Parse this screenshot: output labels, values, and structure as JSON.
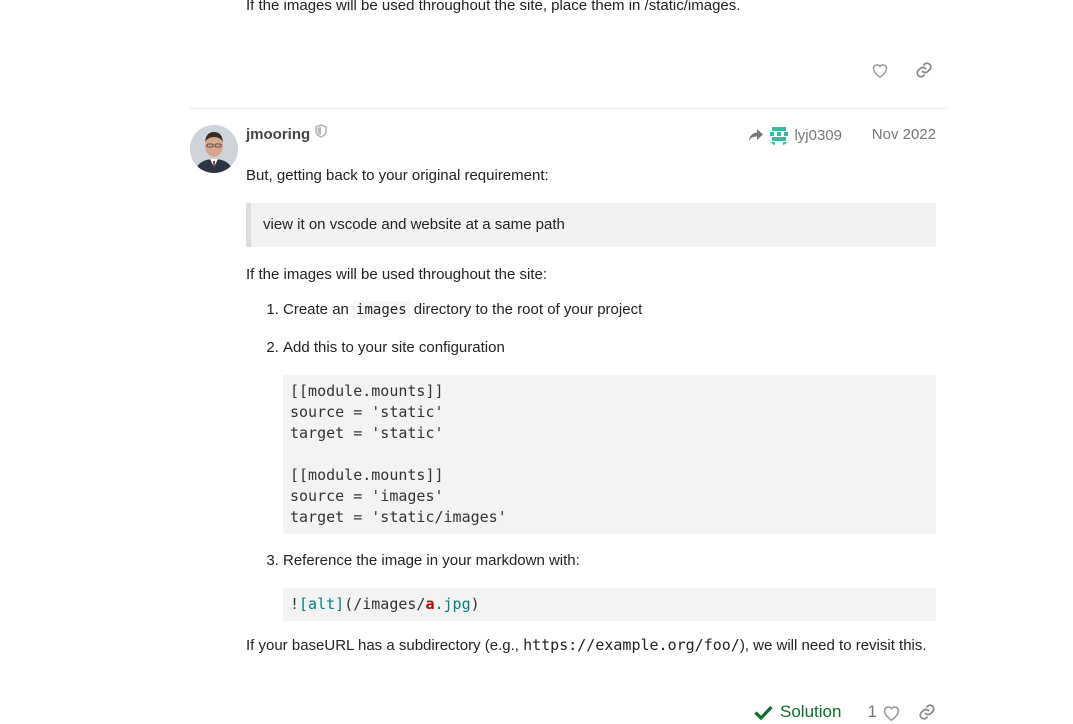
{
  "previous_post": {
    "text": "If the images will be used throughout the site, place them in /static/images."
  },
  "post": {
    "username": "jmooring",
    "reply_to_user": "lyj0309",
    "date": "Nov 2022",
    "intro": "But, getting back to your original requirement:",
    "quote": "view it on vscode and website at a same path",
    "lead": "If the images will be used throughout the site:",
    "step1_before": "Create an ",
    "step1_code": "images",
    "step1_after": " directory to the root of your project",
    "step2": "Add this to your site configuration",
    "config_code": "[[module.mounts]]\nsource = 'static'\ntarget = 'static'\n\n[[module.mounts]]\nsource = 'images'\ntarget = 'static/images'",
    "step3": "Reference the image in your markdown with:",
    "md_bang": "!",
    "md_alt": "[alt]",
    "md_path_open": "(/images/",
    "md_a": "a",
    "md_dot": ".",
    "md_ext": "jpg",
    "md_close": ")",
    "outro_before": "If your baseURL has a subdirectory (e.g., ",
    "outro_code": "https://example.org/foo/",
    "outro_after": "), we will need to revisit this.",
    "solution_label": "Solution",
    "like_count": "1"
  },
  "colors": {
    "solution_green": "#0b6d2e",
    "muted": "#777777"
  },
  "icons": [
    "heart-icon",
    "link-icon",
    "shield-icon",
    "reply-arrow-icon",
    "check-icon"
  ]
}
